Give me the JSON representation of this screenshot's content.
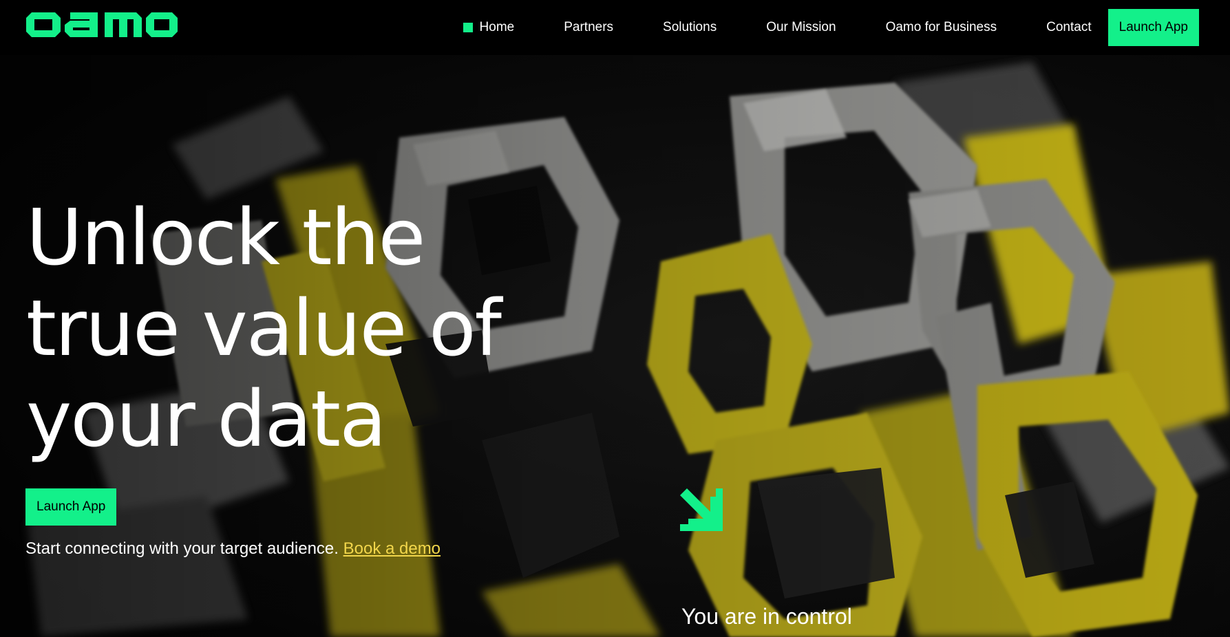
{
  "header": {
    "logo_text": "oamo",
    "nav": [
      {
        "label": "Home",
        "active": true
      },
      {
        "label": "Partners",
        "active": false
      },
      {
        "label": "Solutions",
        "active": false
      },
      {
        "label": "Our Mission",
        "active": false
      },
      {
        "label": "Oamo for Business",
        "active": false
      },
      {
        "label": "Contact",
        "active": false
      }
    ],
    "launch_label": "Launch App"
  },
  "hero": {
    "title_lines": [
      "Unlock the",
      "true value of",
      "your data"
    ],
    "launch_label": "Launch App",
    "subtitle": "Start connecting with your target audience.",
    "demo_link": "Book a demo",
    "control_text": "You are in control"
  },
  "colors": {
    "accent": "#13f08a",
    "link": "#f2d64b",
    "background": "#000000"
  },
  "icons": {
    "logo": "oamo-logo",
    "arrow": "arrow-down-right-icon"
  }
}
